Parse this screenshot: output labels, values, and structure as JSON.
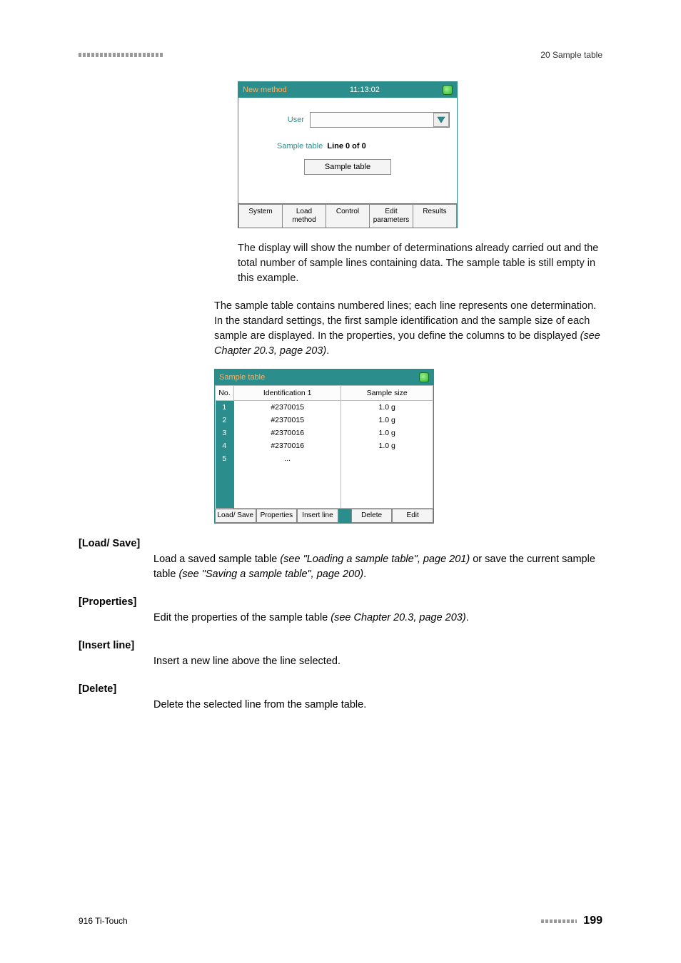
{
  "header": {
    "chapter": "20 Sample table"
  },
  "screenshot1": {
    "title": "New method",
    "time": "11:13:02",
    "user_label": "User",
    "sample_table_label": "Sample table",
    "line_info": "Line 0 of 0",
    "sample_table_btn": "Sample table",
    "tabs": {
      "system": "System",
      "load": "Load method",
      "control": "Control",
      "edit": "Edit parameters",
      "results": "Results"
    }
  },
  "para1": "The display will show the number of determinations already carried out and the total number of sample lines containing data. The sample table is still empty in this example.",
  "para2_a": "The sample table contains numbered lines; each line represents one determination. In the standard settings, the first sample identification and the sample size of each sample are displayed. In the properties, you define the columns to be displayed ",
  "para2_b": "(see Chapter 20.3, page 203)",
  "para2_c": ".",
  "screenshot2": {
    "title": "Sample table",
    "cols": {
      "no": "No.",
      "id": "Identification 1",
      "size": "Sample size"
    },
    "rows": [
      {
        "n": "1",
        "id": "#2370015",
        "size": "1.0 g"
      },
      {
        "n": "2",
        "id": "#2370015",
        "size": "1.0 g"
      },
      {
        "n": "3",
        "id": "#2370016",
        "size": "1.0 g"
      },
      {
        "n": "4",
        "id": "#2370016",
        "size": "1.0 g"
      },
      {
        "n": "5",
        "id": "...",
        "size": ""
      }
    ],
    "buttons": {
      "loadsave": "Load/ Save",
      "properties": "Properties",
      "insert": "Insert line",
      "delete": "Delete",
      "edit": "Edit"
    }
  },
  "terms": {
    "loadsave": {
      "label": "[Load/ Save]",
      "desc_a": "Load a saved sample table ",
      "desc_b": "(see \"Loading a sample table\", page 201)",
      "desc_c": " or save the current sample table ",
      "desc_d": "(see \"Saving a sample table\", page 200)",
      "desc_e": "."
    },
    "properties": {
      "label": "[Properties]",
      "desc_a": "Edit the properties of the sample table ",
      "desc_b": "(see Chapter 20.3, page 203)",
      "desc_c": "."
    },
    "insert": {
      "label": "[Insert line]",
      "desc": "Insert a new line above the line selected."
    },
    "delete": {
      "label": "[Delete]",
      "desc": "Delete the selected line from the sample table."
    }
  },
  "footer": {
    "product": "916 Ti-Touch",
    "page": "199"
  }
}
